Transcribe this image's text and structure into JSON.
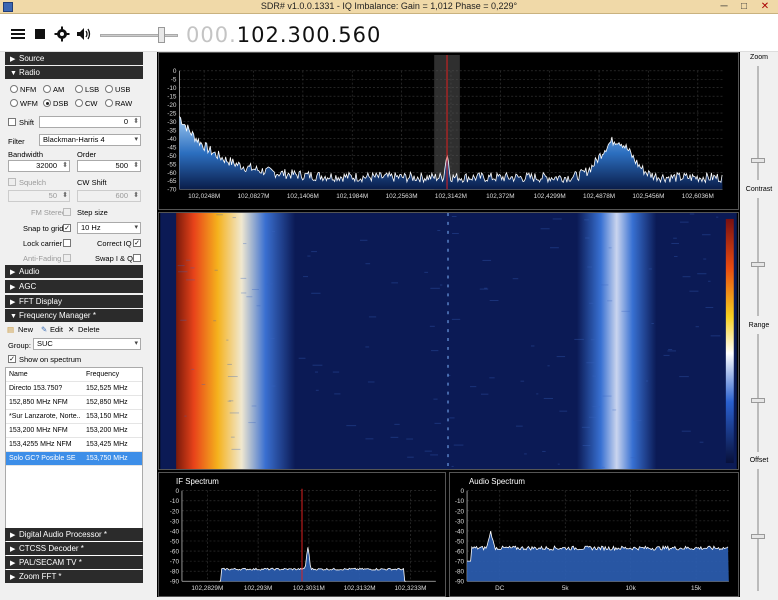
{
  "window": {
    "title": "SDR# v1.0.0.1331 - IQ Imbalance: Gain = 1,012 Phase = 0,229°",
    "minimize": "─",
    "maximize": "□",
    "close": "✕"
  },
  "toolbar": {
    "icons": [
      "menu-icon",
      "stop-icon",
      "gear-icon",
      "speaker-icon"
    ],
    "freq_prefix": "000.",
    "freq_value": "102.300.560"
  },
  "sidebar": {
    "source_header": "Source",
    "radio_header": "Radio",
    "modes": [
      "NFM",
      "AM",
      "LSB",
      "USB",
      "WFM",
      "DSB",
      "CW",
      "RAW"
    ],
    "selected_mode": "DSB",
    "shift_label": "Shift",
    "shift_value": "0",
    "filter_label": "Filter",
    "filter_value": "Blackman-Harris 4",
    "bandwidth_label": "Bandwidth",
    "bandwidth_value": "32000",
    "order_label": "Order",
    "order_value": "500",
    "squelch_label": "Squelch",
    "cwshift_label": "CW Shift",
    "squelch_value": "50",
    "cwshift_value": "600",
    "fmstereo_label": "FM Stereo",
    "stepsize_label": "Step size",
    "snap_label": "Snap to grid",
    "snap_value": "10 Hz",
    "lockcarrier_label": "Lock carrier",
    "correctiq_label": "Correct IQ",
    "antifading_label": "Anti-Fading",
    "swapiq_label": "Swap I & Q",
    "audio_header": "Audio",
    "agc_header": "AGC",
    "fft_header": "FFT Display",
    "fm_header": "Frequency Manager *",
    "new_label": "New",
    "edit_label": "Edit",
    "delete_label": "Delete",
    "group_label": "Group:",
    "group_value": "SUC",
    "show_spectrum_label": "Show on spectrum",
    "table_headers": [
      "Name",
      "Frequency"
    ],
    "table_rows": [
      [
        "Directo 153.750?",
        "152,525 MHz"
      ],
      [
        "152,850 MHz NFM",
        "152,850 MHz"
      ],
      [
        "*Sur Lanzarote, Norte...",
        "153,150 MHz"
      ],
      [
        "153,200 MHz NFM",
        "153,200 MHz"
      ],
      [
        "153,4255 MHz NFM",
        "153,425 MHz"
      ],
      [
        "Solo GC? Posible SE",
        "153,750 MHz"
      ]
    ],
    "dap_header": "Digital Audio Processor *",
    "ctcss_header": "CTCSS Decoder *",
    "pal_header": "PAL/SECAM TV *",
    "zoom_header": "Zoom FFT *"
  },
  "right": {
    "zoom": "Zoom",
    "contrast": "Contrast",
    "range": "Range",
    "offset": "Offset"
  },
  "spectrum": {
    "y_ticks": [
      "0",
      "-5",
      "-10",
      "-15",
      "-20",
      "-25",
      "-30",
      "-35",
      "-40",
      "-45",
      "-50",
      "-55",
      "-60",
      "-65",
      "-70"
    ],
    "x_ticks": [
      "102,0248M",
      "102,0827M",
      "102,1406M",
      "102,1984M",
      "102,2563M",
      "102,3142M",
      "102,372M",
      "102,4299M",
      "102,4878M",
      "102,5456M",
      "102,6036M"
    ]
  },
  "if_spectrum": {
    "title": "IF Spectrum",
    "y_ticks": [
      "0",
      "-10",
      "-20",
      "-30",
      "-40",
      "-50",
      "-60",
      "-70",
      "-80",
      "-90"
    ],
    "x_ticks": [
      "102,2829M",
      "102,293M",
      "102,3031M",
      "102,3132M",
      "102,3233M"
    ]
  },
  "audio_spectrum": {
    "title": "Audio Spectrum",
    "y_ticks": [
      "0",
      "-10",
      "-20",
      "-30",
      "-40",
      "-50",
      "-60",
      "-70",
      "-80",
      "-90"
    ],
    "x_ticks": [
      "DC",
      "5k",
      "10k",
      "15k"
    ]
  },
  "colors": {
    "accent": "#3d8ee8",
    "panel_header": "#2b2b2b",
    "marker": "#e02020"
  }
}
